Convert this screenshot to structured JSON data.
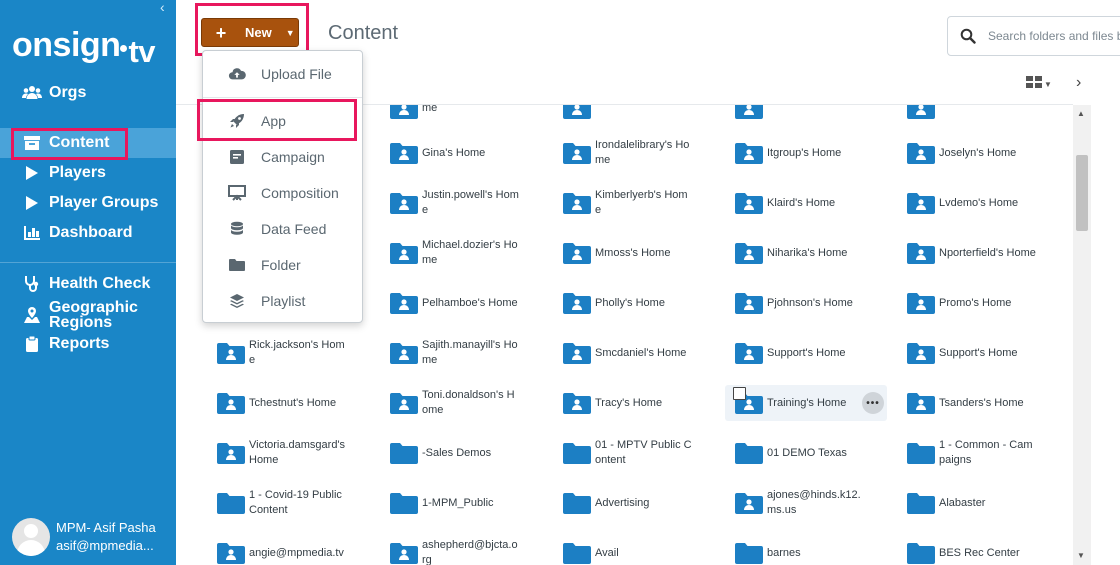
{
  "sidebar": {
    "logo": {
      "main": "onsign",
      "suffix": "tv"
    },
    "items": [
      {
        "label": "Orgs",
        "icon": "users-icon"
      },
      {
        "label": "Content",
        "icon": "content-box-icon",
        "active": true
      },
      {
        "label": "Players",
        "icon": "play-icon"
      },
      {
        "label": "Player Groups",
        "icon": "play-icon"
      },
      {
        "label": "Dashboard",
        "icon": "bar-chart-icon"
      },
      {
        "label": "Health Check",
        "icon": "stethoscope-icon"
      },
      {
        "label_line1": "Geographic",
        "label_line2": "Regions",
        "icon": "map-marker-icon"
      },
      {
        "label": "Reports",
        "icon": "clipboard-icon"
      }
    ],
    "user": {
      "name": "MPM- Asif Pasha",
      "email": "asif@mpmedia..."
    }
  },
  "header": {
    "new_button": {
      "plus": "+",
      "label": "New"
    },
    "title": "Content",
    "search": {
      "placeholder": "Search folders and files b"
    }
  },
  "new_menu": {
    "items": [
      {
        "label": "Upload File",
        "icon": "cloud-upload-icon"
      },
      {
        "label": "App",
        "icon": "rocket-icon"
      },
      {
        "label": "Campaign",
        "icon": "campaign-icon"
      },
      {
        "label": "Composition",
        "icon": "easel-icon"
      },
      {
        "label": "Data Feed",
        "icon": "database-icon"
      },
      {
        "label": "Folder",
        "icon": "folder-icon"
      },
      {
        "label": "Playlist",
        "icon": "layers-icon"
      }
    ]
  },
  "grid": {
    "rows": [
      [
        "",
        "me",
        "",
        "",
        ""
      ],
      [
        "",
        "Gina's Home",
        "Irondalelibrary's Home",
        "Itgroup's Home",
        "Joselyn's Home"
      ],
      [
        "",
        "Justin.powell's Home",
        "Kimberlyerb's Home",
        "Klaird's Home",
        "Lvdemo's Home"
      ],
      [
        "",
        "Michael.dozier's Home",
        "Mmoss's Home",
        "Niharika's Home",
        "Nporterfield's Home"
      ],
      [
        "",
        "Pelhamboe's Home",
        "Pholly's Home",
        "Pjohnson's Home",
        "Promo's Home"
      ],
      [
        "Rick.jackson's Home",
        "Sajith.manayill's Home",
        "Smcdaniel's Home",
        "Support's Home",
        "Support's Home"
      ],
      [
        "Tchestnut's Home",
        "Toni.donaldson's Home",
        "Tracy's Home",
        "Training's Home",
        "Tsanders's Home"
      ],
      [
        "Victoria.damsgard's Home",
        "-Sales Demos",
        "01 - MPTV Public Content",
        "01 DEMO Texas",
        "1 - Common - Campaigns"
      ],
      [
        "1 - Covid-19 Public Content",
        "1-MPM_Public",
        "Advertising",
        "ajones@hinds.k12.ms.us",
        "Alabaster"
      ],
      [
        "angie@mpmedia.tv",
        "ashepherd@bjcta.org",
        "Avail",
        "barnes",
        "BES Rec Center"
      ]
    ],
    "home_icon": [
      [
        false,
        true,
        true,
        true,
        true
      ],
      [
        false,
        true,
        true,
        true,
        true
      ],
      [
        false,
        true,
        true,
        true,
        true
      ],
      [
        false,
        true,
        true,
        true,
        true
      ],
      [
        false,
        true,
        true,
        true,
        true
      ],
      [
        true,
        true,
        true,
        true,
        true
      ],
      [
        true,
        true,
        true,
        true,
        true
      ],
      [
        true,
        false,
        false,
        false,
        false
      ],
      [
        false,
        false,
        false,
        true,
        false
      ],
      [
        true,
        true,
        false,
        false,
        false
      ]
    ]
  },
  "colors": {
    "sidebar_bg": "#1a86c7",
    "sidebar_active": "#4aa3d9",
    "new_button": "#a8520d",
    "folder": "#1c7fc4",
    "highlight": "#e8175d"
  }
}
